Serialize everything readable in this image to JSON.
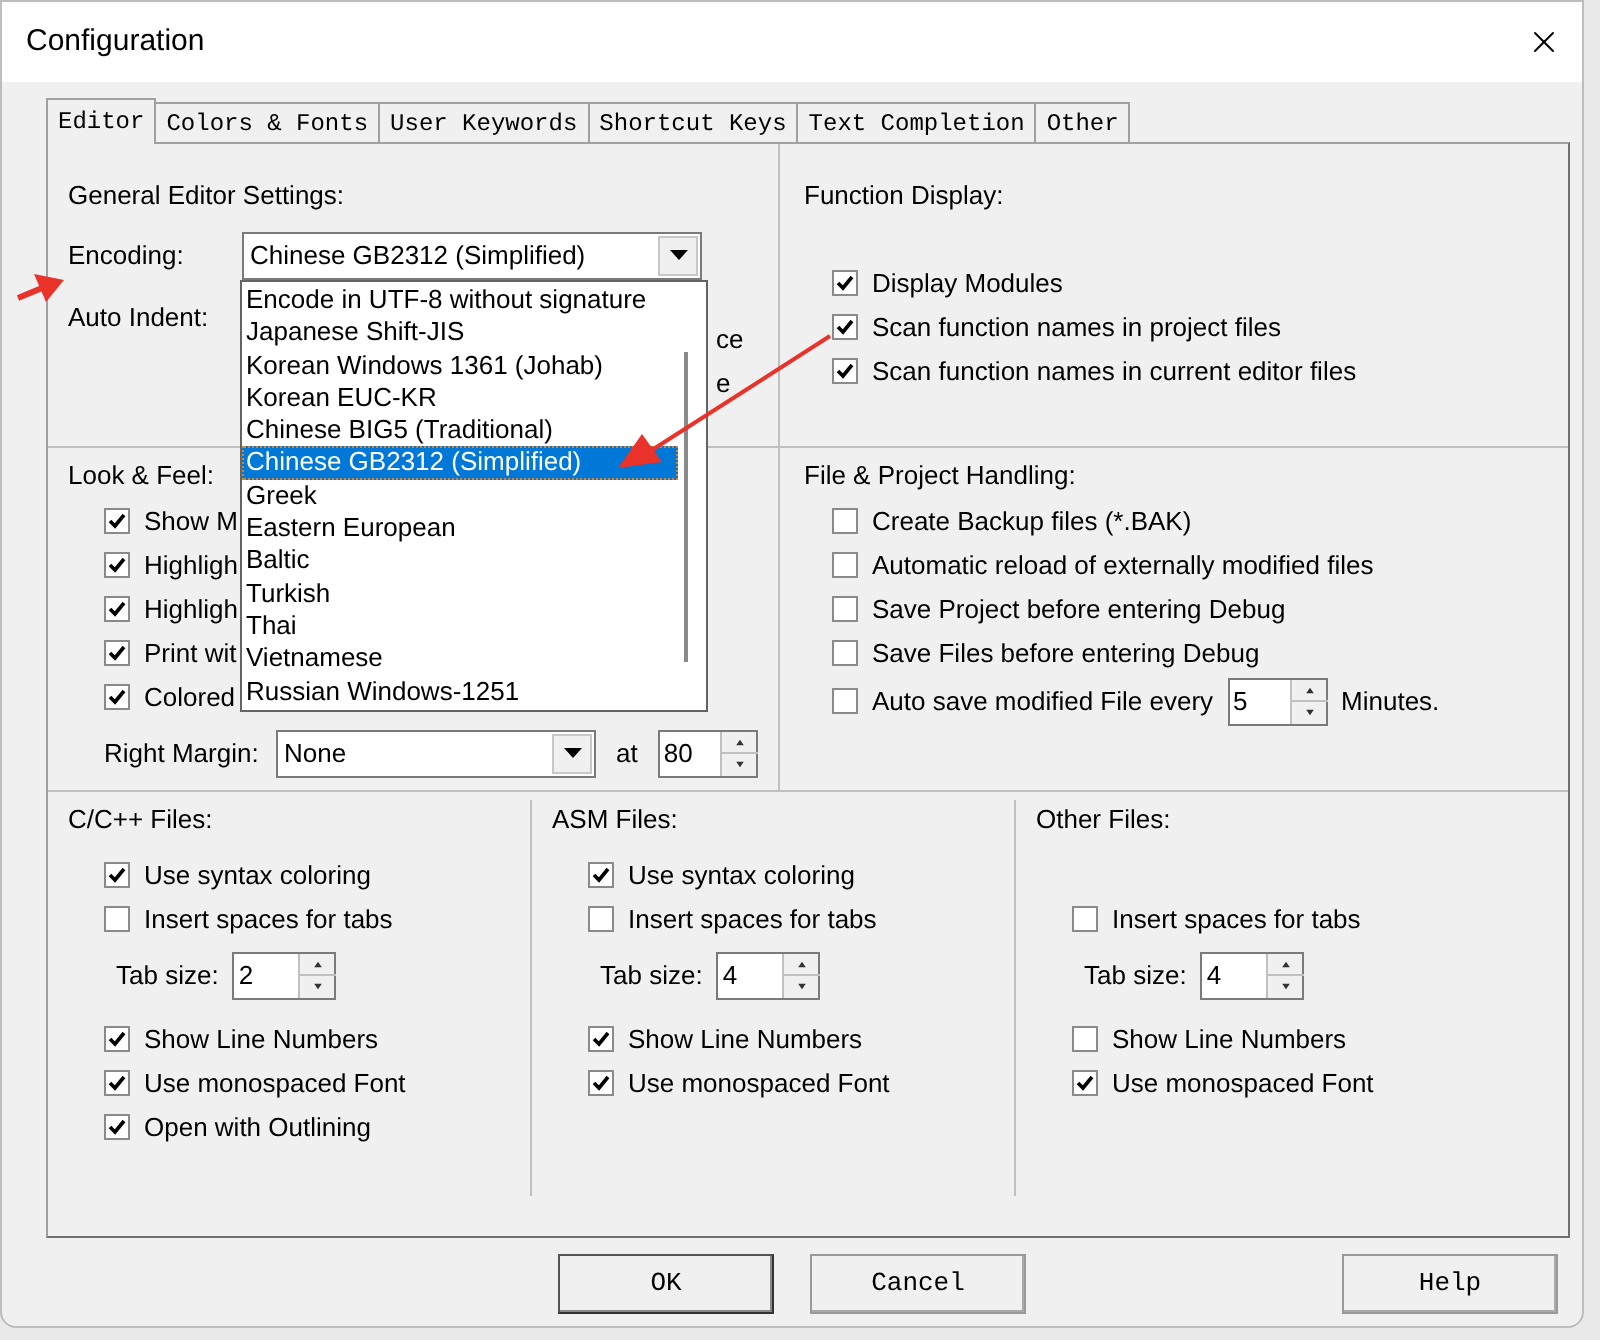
{
  "window": {
    "title": "Configuration"
  },
  "tabs": [
    {
      "label": "Editor",
      "selected": true
    },
    {
      "label": "Colors & Fonts",
      "selected": false
    },
    {
      "label": "User Keywords",
      "selected": false
    },
    {
      "label": "Shortcut Keys",
      "selected": false
    },
    {
      "label": "Text Completion",
      "selected": false
    },
    {
      "label": "Other",
      "selected": false
    }
  ],
  "general": {
    "title": "General Editor Settings:",
    "encoding_label": "Encoding:",
    "encoding_value": "Chinese GB2312 (Simplified)",
    "auto_indent_label": "Auto Indent:",
    "fragments": [
      "ce",
      "e"
    ]
  },
  "encoding_list": [
    {
      "label": "Encode in UTF-8 without signature",
      "selected": false
    },
    {
      "label": "Japanese Shift-JIS",
      "selected": false
    },
    {
      "label": "Korean Windows 1361 (Johab)",
      "selected": false
    },
    {
      "label": "Korean EUC-KR",
      "selected": false
    },
    {
      "label": "Chinese BIG5 (Traditional)",
      "selected": false
    },
    {
      "label": "Chinese GB2312 (Simplified)",
      "selected": true
    },
    {
      "label": "Greek",
      "selected": false
    },
    {
      "label": "Eastern European",
      "selected": false
    },
    {
      "label": "Baltic",
      "selected": false
    },
    {
      "label": "Turkish",
      "selected": false
    },
    {
      "label": "Thai",
      "selected": false
    },
    {
      "label": "Vietnamese",
      "selected": false
    },
    {
      "label": "Russian Windows-1251",
      "selected": false
    }
  ],
  "function_display": {
    "title": "Function Display:",
    "options": [
      {
        "label": "Display Modules",
        "checked": true
      },
      {
        "label": "Scan function names in project files",
        "checked": true
      },
      {
        "label": "Scan function names in current editor files",
        "checked": true
      }
    ]
  },
  "look_feel": {
    "title": "Look & Feel:",
    "options": [
      {
        "label": "Show M",
        "checked": true
      },
      {
        "label": "Highligh",
        "checked": true
      },
      {
        "label": "Highligh",
        "checked": true
      },
      {
        "label": "Print wit",
        "checked": true
      },
      {
        "label": "Colored",
        "checked": true
      }
    ],
    "right_margin_label": "Right Margin:",
    "right_margin_value": "None",
    "at_label": "at",
    "at_value": "80"
  },
  "file_handling": {
    "title": "File & Project Handling:",
    "options": [
      {
        "kind": "checkbox",
        "label": "Create Backup files (*.BAK)",
        "checked": false
      },
      {
        "kind": "checkbox",
        "label": "Automatic reload of externally modified files",
        "checked": false
      },
      {
        "kind": "checkbox",
        "label": "Save Project before entering Debug",
        "checked": false
      },
      {
        "kind": "checkbox",
        "label": "Save Files before entering Debug",
        "checked": false
      },
      {
        "kind": "autosave",
        "label": "Auto save modified File every",
        "checked": false,
        "value": "5",
        "unit": "Minutes."
      }
    ]
  },
  "file_groups": [
    {
      "title": "C/C++ Files:",
      "rows": [
        {
          "kind": "checkbox",
          "label": "Use syntax coloring",
          "checked": true
        },
        {
          "kind": "checkbox",
          "label": "Insert spaces for tabs",
          "checked": false
        },
        {
          "kind": "tab_size",
          "label": "Tab size:",
          "value": "2"
        },
        {
          "kind": "checkbox",
          "label": "Show Line Numbers",
          "checked": true
        },
        {
          "kind": "checkbox",
          "label": "Use monospaced Font",
          "checked": true
        },
        {
          "kind": "checkbox",
          "label": "Open with Outlining",
          "checked": true
        }
      ]
    },
    {
      "title": "ASM Files:",
      "rows": [
        {
          "kind": "checkbox",
          "label": "Use syntax coloring",
          "checked": true
        },
        {
          "kind": "checkbox",
          "label": "Insert spaces for tabs",
          "checked": false
        },
        {
          "kind": "tab_size",
          "label": "Tab size:",
          "value": "4"
        },
        {
          "kind": "checkbox",
          "label": "Show Line Numbers",
          "checked": true
        },
        {
          "kind": "checkbox",
          "label": "Use monospaced Font",
          "checked": true
        }
      ]
    },
    {
      "title": "Other Files:",
      "rows": [
        {
          "kind": "spacer"
        },
        {
          "kind": "checkbox",
          "label": "Insert spaces for tabs",
          "checked": false
        },
        {
          "kind": "tab_size",
          "label": "Tab size:",
          "value": "4"
        },
        {
          "kind": "checkbox",
          "label": "Show Line Numbers",
          "checked": false
        },
        {
          "kind": "checkbox",
          "label": "Use monospaced Font",
          "checked": true
        }
      ]
    }
  ],
  "buttons": [
    {
      "label": "OK",
      "kind": "default"
    },
    {
      "label": "Cancel",
      "kind": "normal"
    },
    {
      "label": "Help",
      "kind": "normal"
    }
  ]
}
